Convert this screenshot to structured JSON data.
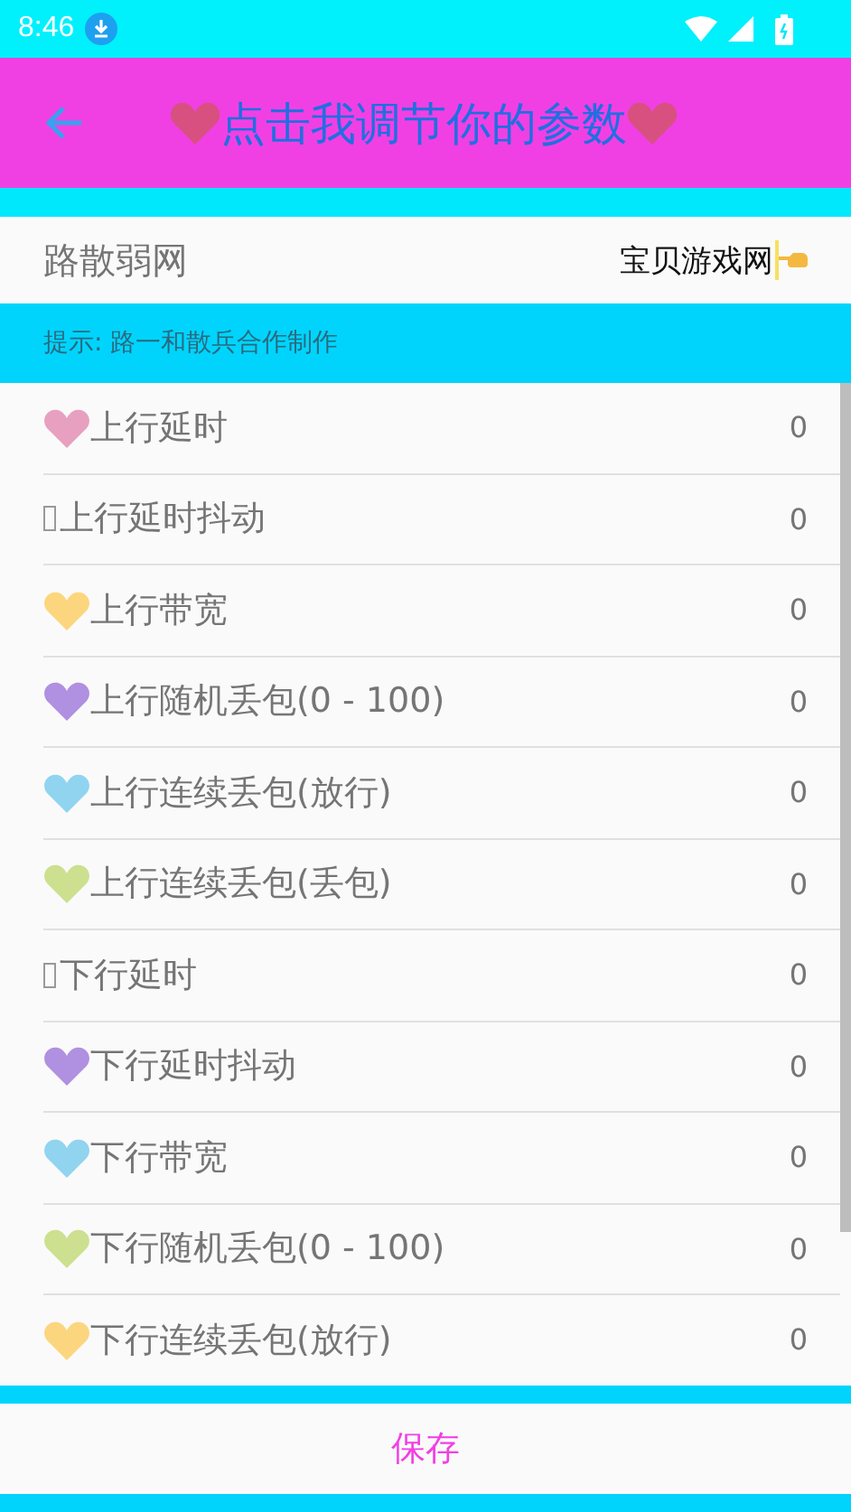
{
  "status_bar": {
    "time": "8:46"
  },
  "toolbar": {
    "title": "点击我调节你的参数"
  },
  "name_row": {
    "label": "路散弱网",
    "value": "宝贝游戏网"
  },
  "hint": "提示: 路一和散兵合作制作",
  "params": [
    {
      "kind": "heart",
      "color": "#e8a0c0",
      "label": "上行延时",
      "value": "0"
    },
    {
      "kind": "missing",
      "label": "上行延时抖动",
      "value": "0"
    },
    {
      "kind": "heart",
      "color": "#fcd67e",
      "label": "上行带宽",
      "value": "0"
    },
    {
      "kind": "heart",
      "color": "#b090e0",
      "label": "上行随机丢包(0 - 100)",
      "value": "0"
    },
    {
      "kind": "heart",
      "color": "#90d4f0",
      "label": "上行连续丢包(放行)",
      "value": "0"
    },
    {
      "kind": "heart",
      "color": "#cce090",
      "label": "上行连续丢包(丢包)",
      "value": "0"
    },
    {
      "kind": "missing",
      "label": "下行延时",
      "value": "0"
    },
    {
      "kind": "heart",
      "color": "#b090e0",
      "label": "下行延时抖动",
      "value": "0"
    },
    {
      "kind": "heart",
      "color": "#90d4f0",
      "label": "下行带宽",
      "value": "0"
    },
    {
      "kind": "heart",
      "color": "#cce090",
      "label": "下行随机丢包(0 - 100)",
      "value": "0"
    },
    {
      "kind": "heart",
      "color": "#fcd67e",
      "label": "下行连续丢包(放行)",
      "value": "0"
    }
  ],
  "save_button": "保存"
}
